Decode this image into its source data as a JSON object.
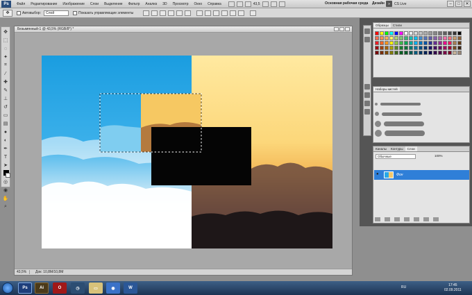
{
  "menubar": {
    "logo": "Ps",
    "items": [
      "Файл",
      "Редактирование",
      "Изображение",
      "Слои",
      "Выделение",
      "Фильтр",
      "Анализ",
      "3D",
      "Просмотр",
      "Окно",
      "Справка"
    ],
    "zoom": "43,5",
    "workspace": "Основная рабочая среда",
    "design": "Дизайн",
    "cslive": "CS Live"
  },
  "optbar": {
    "autoselect": "Автовыбор:",
    "autoselect_value": "Слой",
    "show_controls": "Показать управляющие элементы"
  },
  "document": {
    "tab_title": "Безымянный-1 @ 43,5% (RGB/8*) *",
    "zoom": "43,5%",
    "doc_info": "Док: 10,8M/10,8M"
  },
  "panels": {
    "swatches_tabs": [
      "Образцы",
      "Стили"
    ],
    "brushes_tabs": [
      "Наборы кистей"
    ],
    "layers_tabs": [
      "Каналы",
      "Контуры",
      "Слои"
    ],
    "layer_blend": "Обычные",
    "layer_opacity": "100%",
    "layer_name": "Фон"
  },
  "taskbar": {
    "apps": [
      "Ps",
      "Ai"
    ],
    "tray_lang": "RU",
    "time": "17:45",
    "date": "02.09.2011"
  }
}
